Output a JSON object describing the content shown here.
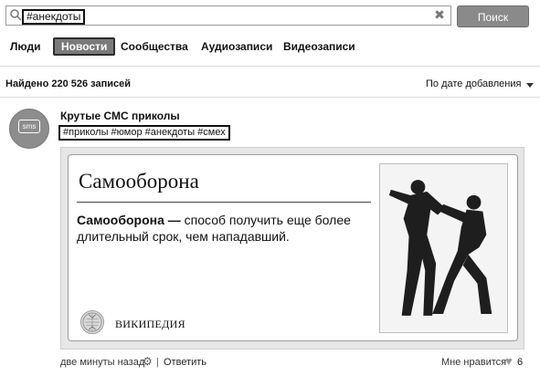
{
  "search": {
    "query": "#анекдоты",
    "button_label": "Поиск"
  },
  "tabs": [
    {
      "label": "Люди",
      "active": false
    },
    {
      "label": "Новости",
      "active": true
    },
    {
      "label": "Сообщества",
      "active": false
    },
    {
      "label": "Аудиозаписи",
      "active": false
    },
    {
      "label": "Видеозаписи",
      "active": false
    }
  ],
  "results": {
    "count_text": "Найдено 220 526 записей",
    "sort_label": "По дате добавления"
  },
  "post": {
    "avatar_text": "sms",
    "author": "Крутые СМС приколы",
    "tags": "#приколы #юмор #анекдоты #смех",
    "card": {
      "title": "Самооборона",
      "description_bold": "Самооборона —",
      "description_rest": " способ получить еще более длительный срок, чем нападавший.",
      "source_name": "ВИКИПЕДИЯ"
    },
    "time": "две минуты назад",
    "reply_label": "Ответить",
    "like_label": "Мне нравится",
    "like_count": "6"
  },
  "colors": {
    "active_tab_bg": "#7a7a7a",
    "search_button_bg": "#8a8a8a",
    "avatar_bg": "#8d8d8d",
    "card_frame_bg": "#e6e6e6"
  },
  "icons": {
    "search": "search-icon",
    "clear": "close-icon",
    "sort": "chevron-down-icon",
    "gear": "gear-icon",
    "heart": "heart-icon",
    "wiki": "wikipedia-logo-icon"
  }
}
